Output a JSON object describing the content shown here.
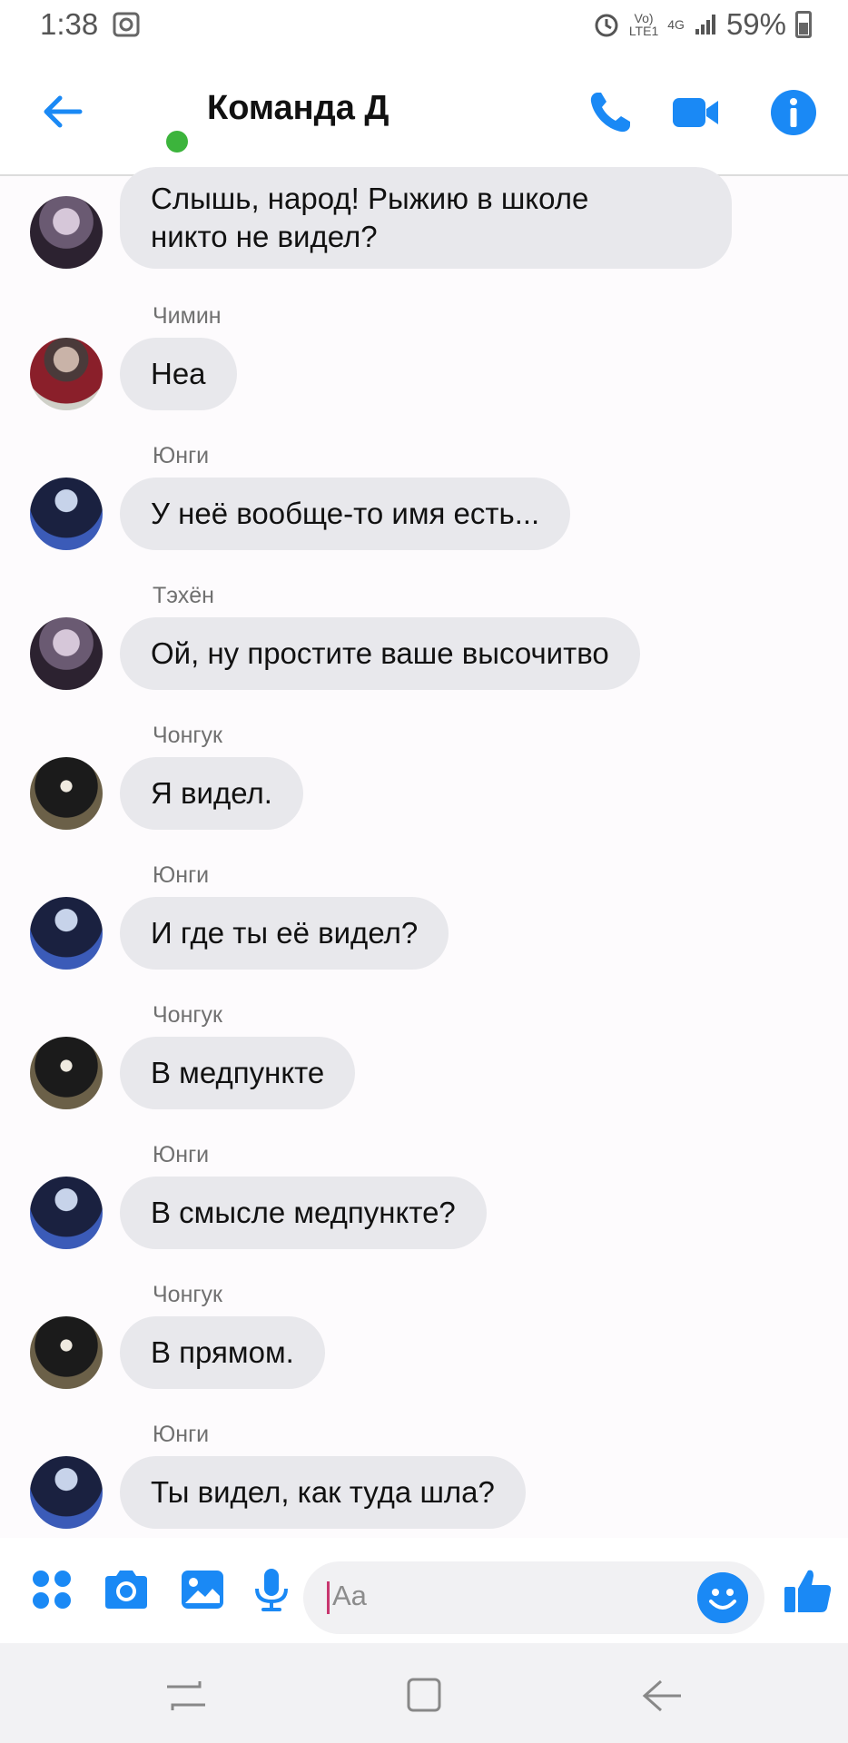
{
  "status_bar": {
    "time": "1:38",
    "network_top": "Vo)",
    "network_bottom": "LTE1",
    "signal_type": "4G",
    "battery": "59%"
  },
  "header": {
    "title": "Команда Д",
    "online_color": "#3cb43c",
    "accent_color": "#1a89f5"
  },
  "messages": [
    {
      "sender": "",
      "text": "Слышь, народ! Рыжию в школе\nникто не видел?",
      "avatar": "taehyung"
    },
    {
      "sender": "Чимин",
      "text": "Неа",
      "avatar": "jimin"
    },
    {
      "sender": "Юнги",
      "text": "У неё вообще-то имя есть...",
      "avatar": "yoongi"
    },
    {
      "sender": "Тэхён",
      "text": "Ой, ну простите ваше высочитво",
      "avatar": "taehyung"
    },
    {
      "sender": "Чонгук",
      "text": "Я видел.",
      "avatar": "jungkook"
    },
    {
      "sender": "Юнги",
      "text": "И где ты её видел?",
      "avatar": "yoongi"
    },
    {
      "sender": "Чонгук",
      "text": "В медпункте",
      "avatar": "jungkook"
    },
    {
      "sender": "Юнги",
      "text": "В смысле медпункте?",
      "avatar": "yoongi"
    },
    {
      "sender": "Чонгук",
      "text": "В прямом.",
      "avatar": "jungkook"
    },
    {
      "sender": "Юнги",
      "text": "Ты видел, как туда шла?",
      "avatar": "yoongi"
    }
  ],
  "composer": {
    "placeholder": "Aa",
    "icons": [
      "grid-icon",
      "camera-icon",
      "gallery-icon",
      "microphone-icon",
      "emoji-icon",
      "thumbs-up-icon"
    ]
  }
}
